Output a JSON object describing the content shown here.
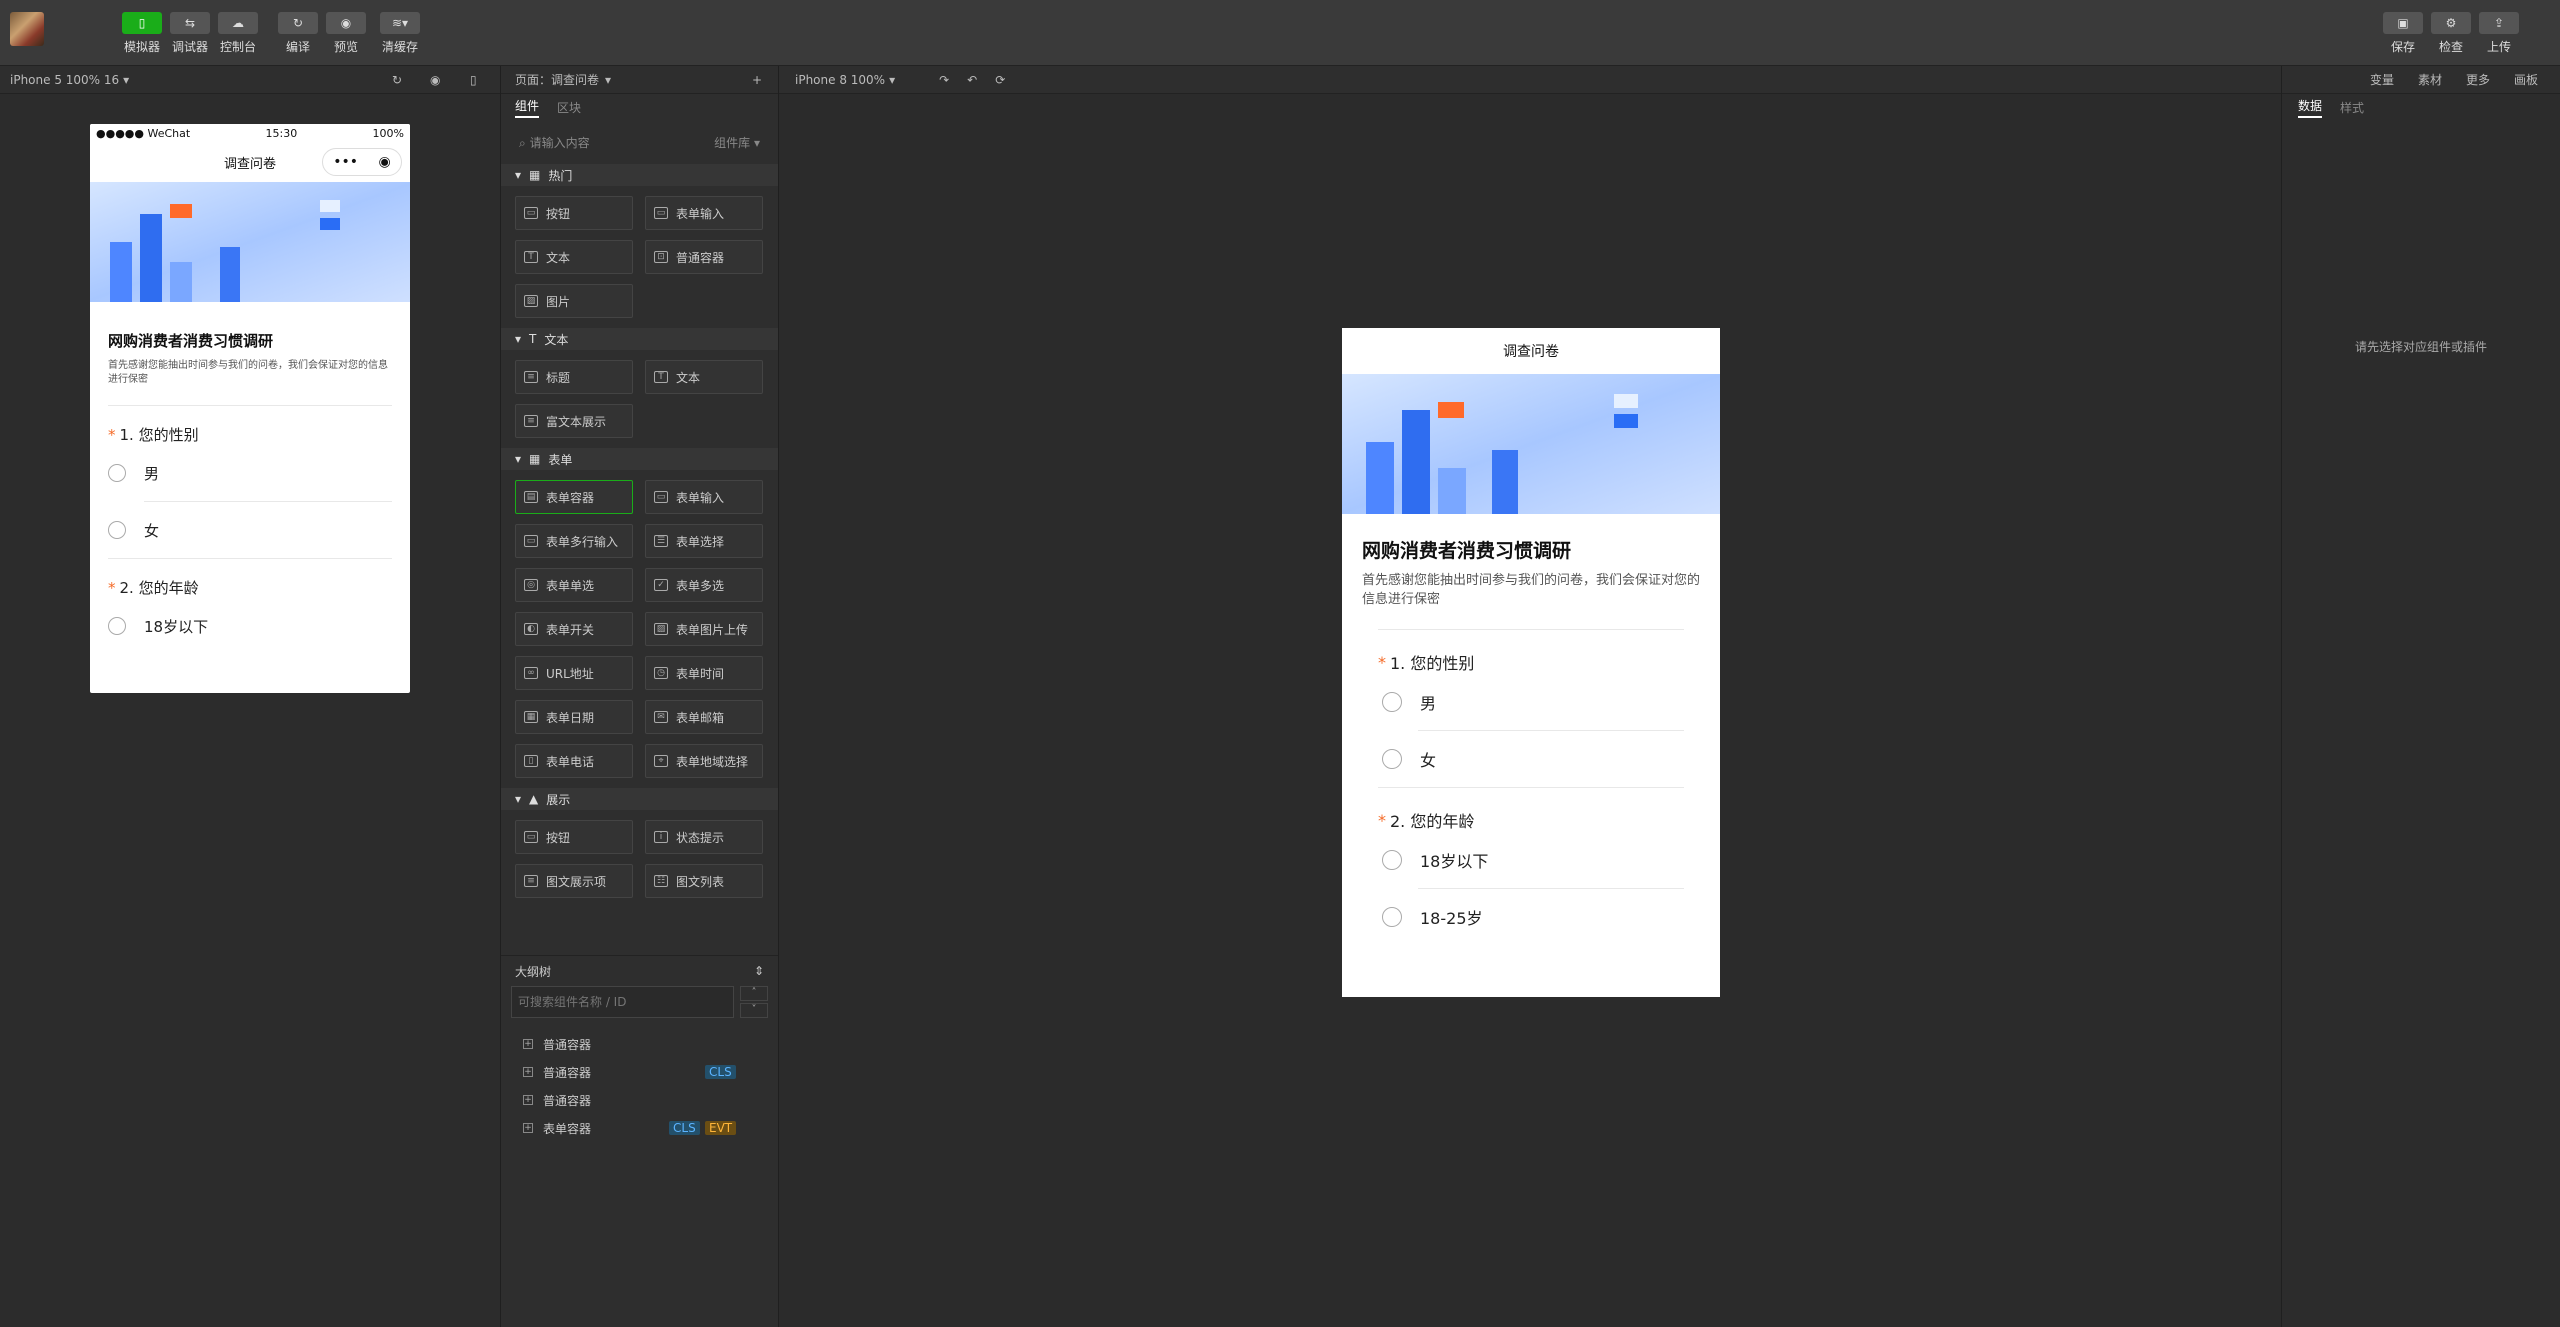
{
  "toolbar": {
    "buttons": [
      {
        "label": "模拟器",
        "icon": "phone-icon"
      },
      {
        "label": "调试器",
        "icon": "swap-icon"
      },
      {
        "label": "控制台",
        "icon": "cloud-icon"
      },
      {
        "label": "编译",
        "icon": "refresh-icon"
      },
      {
        "label": "预览",
        "icon": "eye-icon"
      },
      {
        "label": "清缓存",
        "icon": "stack-icon"
      },
      {
        "label": "保存",
        "icon": "save-icon"
      },
      {
        "label": "检查",
        "icon": "gear-icon"
      },
      {
        "label": "上传",
        "icon": "upload-icon"
      }
    ]
  },
  "simulator": {
    "device": "iPhone 5 100% 16",
    "status": {
      "carrier": "●●●●● WeChat",
      "time": "15:30",
      "battery": "100%"
    },
    "nav_title": "调查问卷"
  },
  "panel": {
    "page_label": "页面：调查问卷",
    "tabs": [
      "组件",
      "区块"
    ],
    "search_placeholder": "请输入内容",
    "library": "组件库",
    "categories": [
      {
        "name": "热门",
        "items": [
          "按钮",
          "表单输入",
          "文本",
          "普通容器",
          "图片"
        ]
      },
      {
        "name": "文本",
        "items": [
          "标题",
          "文本",
          "富文本展示"
        ]
      },
      {
        "name": "表单",
        "items": [
          "表单容器",
          "表单输入",
          "表单多行输入",
          "表单选择",
          "表单单选",
          "表单多选",
          "表单开关",
          "表单图片上传",
          "URL地址",
          "表单时间",
          "表单日期",
          "表单邮箱",
          "表单电话",
          "表单地域选择"
        ]
      },
      {
        "name": "展示",
        "items": [
          "按钮",
          "状态提示",
          "图文展示项",
          "图文列表"
        ]
      }
    ]
  },
  "outline": {
    "title": "大纲树",
    "search_placeholder": "可搜索组件名称 / ID",
    "items": [
      {
        "name": "普通容器",
        "badges": []
      },
      {
        "name": "普通容器",
        "badges": [
          "CLS"
        ]
      },
      {
        "name": "普通容器",
        "badges": []
      },
      {
        "name": "表单容器",
        "badges": [
          "CLS",
          "EVT"
        ]
      }
    ]
  },
  "editor": {
    "device": "iPhone 8 100%",
    "right_links": [
      "变量",
      "素材",
      "更多",
      "画板"
    ],
    "page_title": "调查问卷"
  },
  "form": {
    "title": "网购消费者消费习惯调研",
    "desc": "首先感谢您能抽出时间参与我们的问卷，我们会保证对您的信息进行保密",
    "q1": "1. 您的性别",
    "q1_opts": [
      "男",
      "女"
    ],
    "q2": "2. 您的年龄",
    "q2_opts": [
      "18岁以下",
      "18-25岁"
    ]
  },
  "props": {
    "tabs": [
      "数据",
      "样式"
    ],
    "hint": "请先选择对应组件或插件"
  }
}
